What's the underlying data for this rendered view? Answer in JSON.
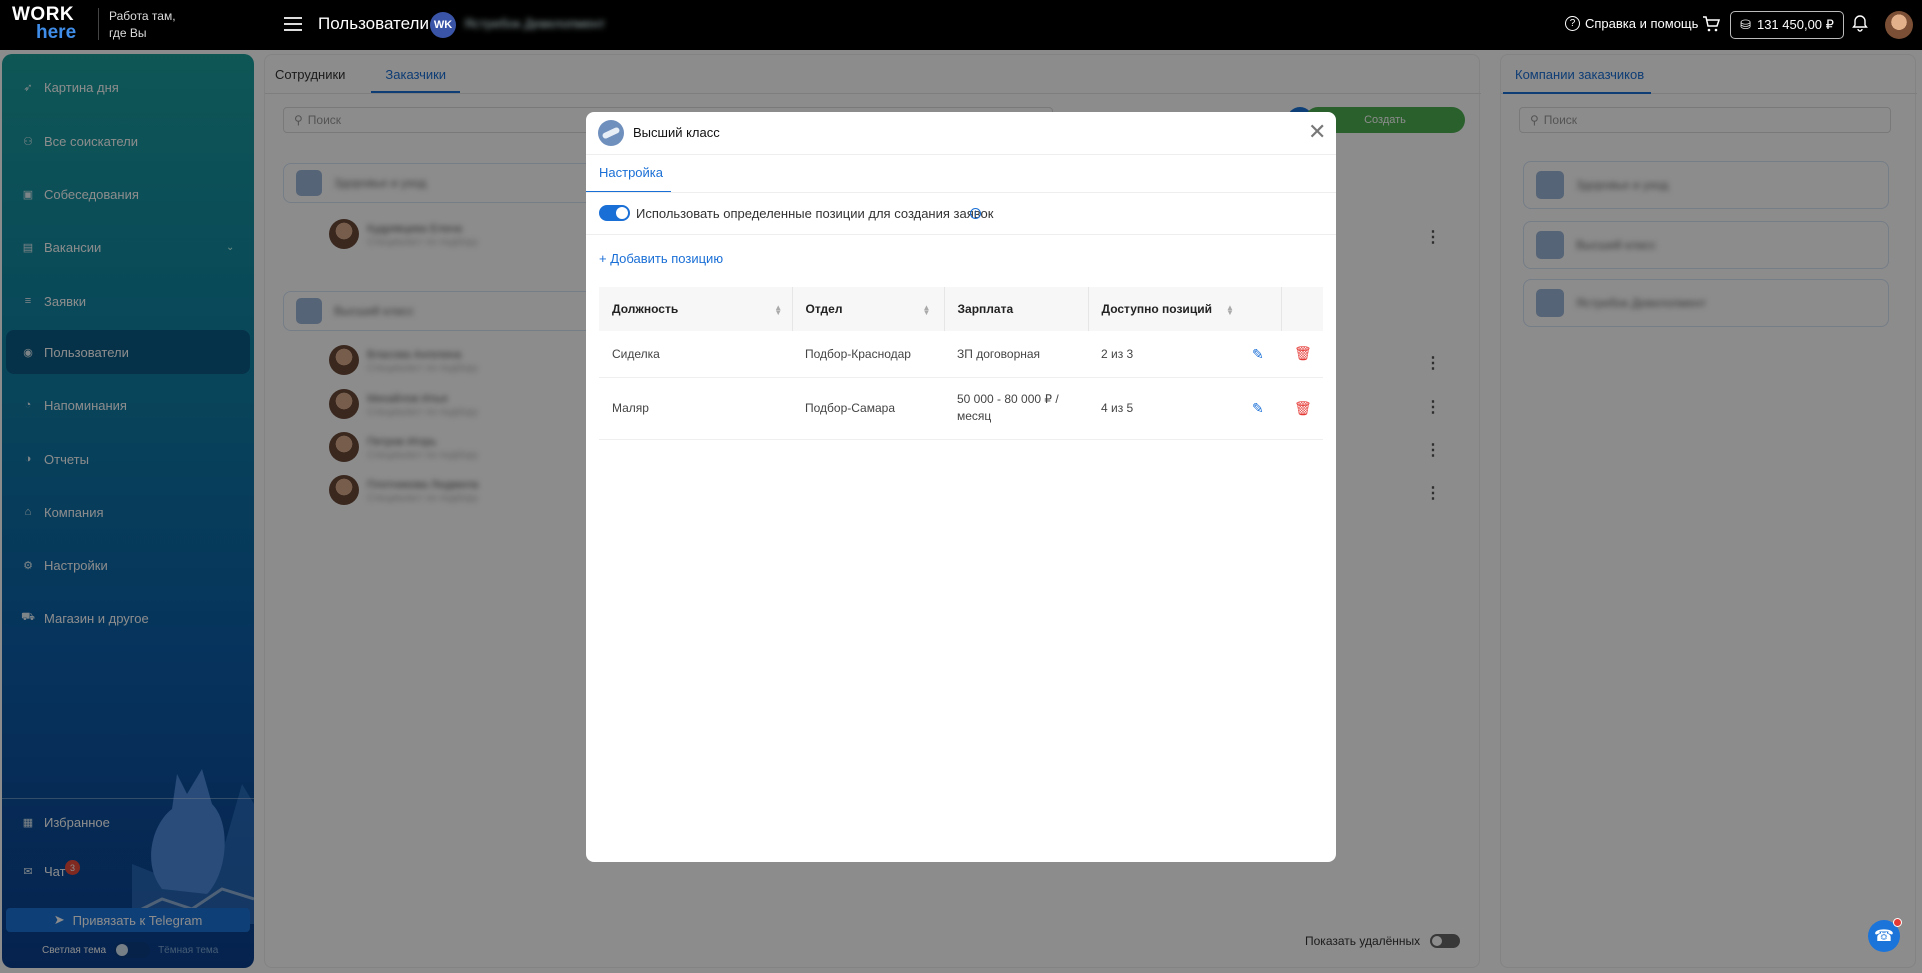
{
  "topbar": {
    "logo_line1": "WORK",
    "logo_line2": "here",
    "slogan_line1": "Работа там,",
    "slogan_line2": "где Вы",
    "page_title": "Пользователи",
    "vk_badge": "WK",
    "vk_company_name": "Ястребок Девелопмент",
    "help_label": "Справка и помощь",
    "balance": "131 450,00 ₽"
  },
  "sidebar": {
    "items": [
      {
        "label": "Картина дня",
        "icon": "rocket-icon"
      },
      {
        "label": "Все соискатели",
        "icon": "people-icon"
      },
      {
        "label": "Собеседования",
        "icon": "calendar-icon"
      },
      {
        "label": "Вакансии",
        "icon": "briefcase-icon"
      },
      {
        "label": "Заявки",
        "icon": "list-icon"
      },
      {
        "label": "Пользователи",
        "icon": "user-icon"
      },
      {
        "label": "Напоминания",
        "icon": "alarm-icon"
      },
      {
        "label": "Отчеты",
        "icon": "chart-icon"
      },
      {
        "label": "Компания",
        "icon": "home-icon"
      },
      {
        "label": "Настройки",
        "icon": "gear-icon"
      },
      {
        "label": "Магазин и другое",
        "icon": "cart-icon"
      }
    ],
    "favorites": "Избранное",
    "chat": "Чат",
    "chat_count": "3",
    "telegram_button": "Привязать к Telegram",
    "theme_light": "Светлая тема",
    "theme_dark": "Тёмная тема"
  },
  "main": {
    "tabs": [
      "Сотрудники",
      "Заказчики"
    ],
    "search_placeholder": "Поиск",
    "create_button": "Создать",
    "groups": [
      {
        "name": "Здоровье и уход",
        "people": [
          {
            "name": "Кудрявцева Елена",
            "sub": "Специалист по подбору"
          }
        ]
      },
      {
        "name": "Высший класс",
        "people": [
          {
            "name": "Власова Ангелина",
            "sub": "Специалист по подбору"
          },
          {
            "name": "Михайлов Илья",
            "sub": "Специалист по подбору"
          },
          {
            "name": "Петров Игорь",
            "sub": "Специалист по подбору"
          },
          {
            "name": "Плотникова Людмила",
            "sub": "Специалист по подбору"
          }
        ]
      }
    ],
    "show_deleted": "Показать удалённых"
  },
  "right_panel": {
    "tab": "Компании заказчиков",
    "search_placeholder": "Поиск",
    "companies": [
      "Здоровье и уход",
      "Высший класс",
      "Ястребок Девелопмент"
    ]
  },
  "modal": {
    "title": "Высший класс",
    "tab": "Настройка",
    "toggle_label": "Использовать определенные позиции для создания заявок",
    "toggle_on": true,
    "add_position": "+ Добавить позицию",
    "columns": [
      "Должность",
      "Отдел",
      "Зарплата",
      "Доступно позиций"
    ],
    "rows": [
      {
        "position": "Сиделка",
        "department": "Подбор-Краснодар",
        "salary": "ЗП договорная",
        "available": "2 из 3"
      },
      {
        "position": "Маляр",
        "department": "Подбор-Самара",
        "salary": "50 000 - 80 000 ₽ / месяц",
        "available": "4 из 5"
      }
    ]
  },
  "colors": {
    "accent": "#1a6fd6",
    "create_green": "#4caf50",
    "delete_red": "#e53935"
  }
}
